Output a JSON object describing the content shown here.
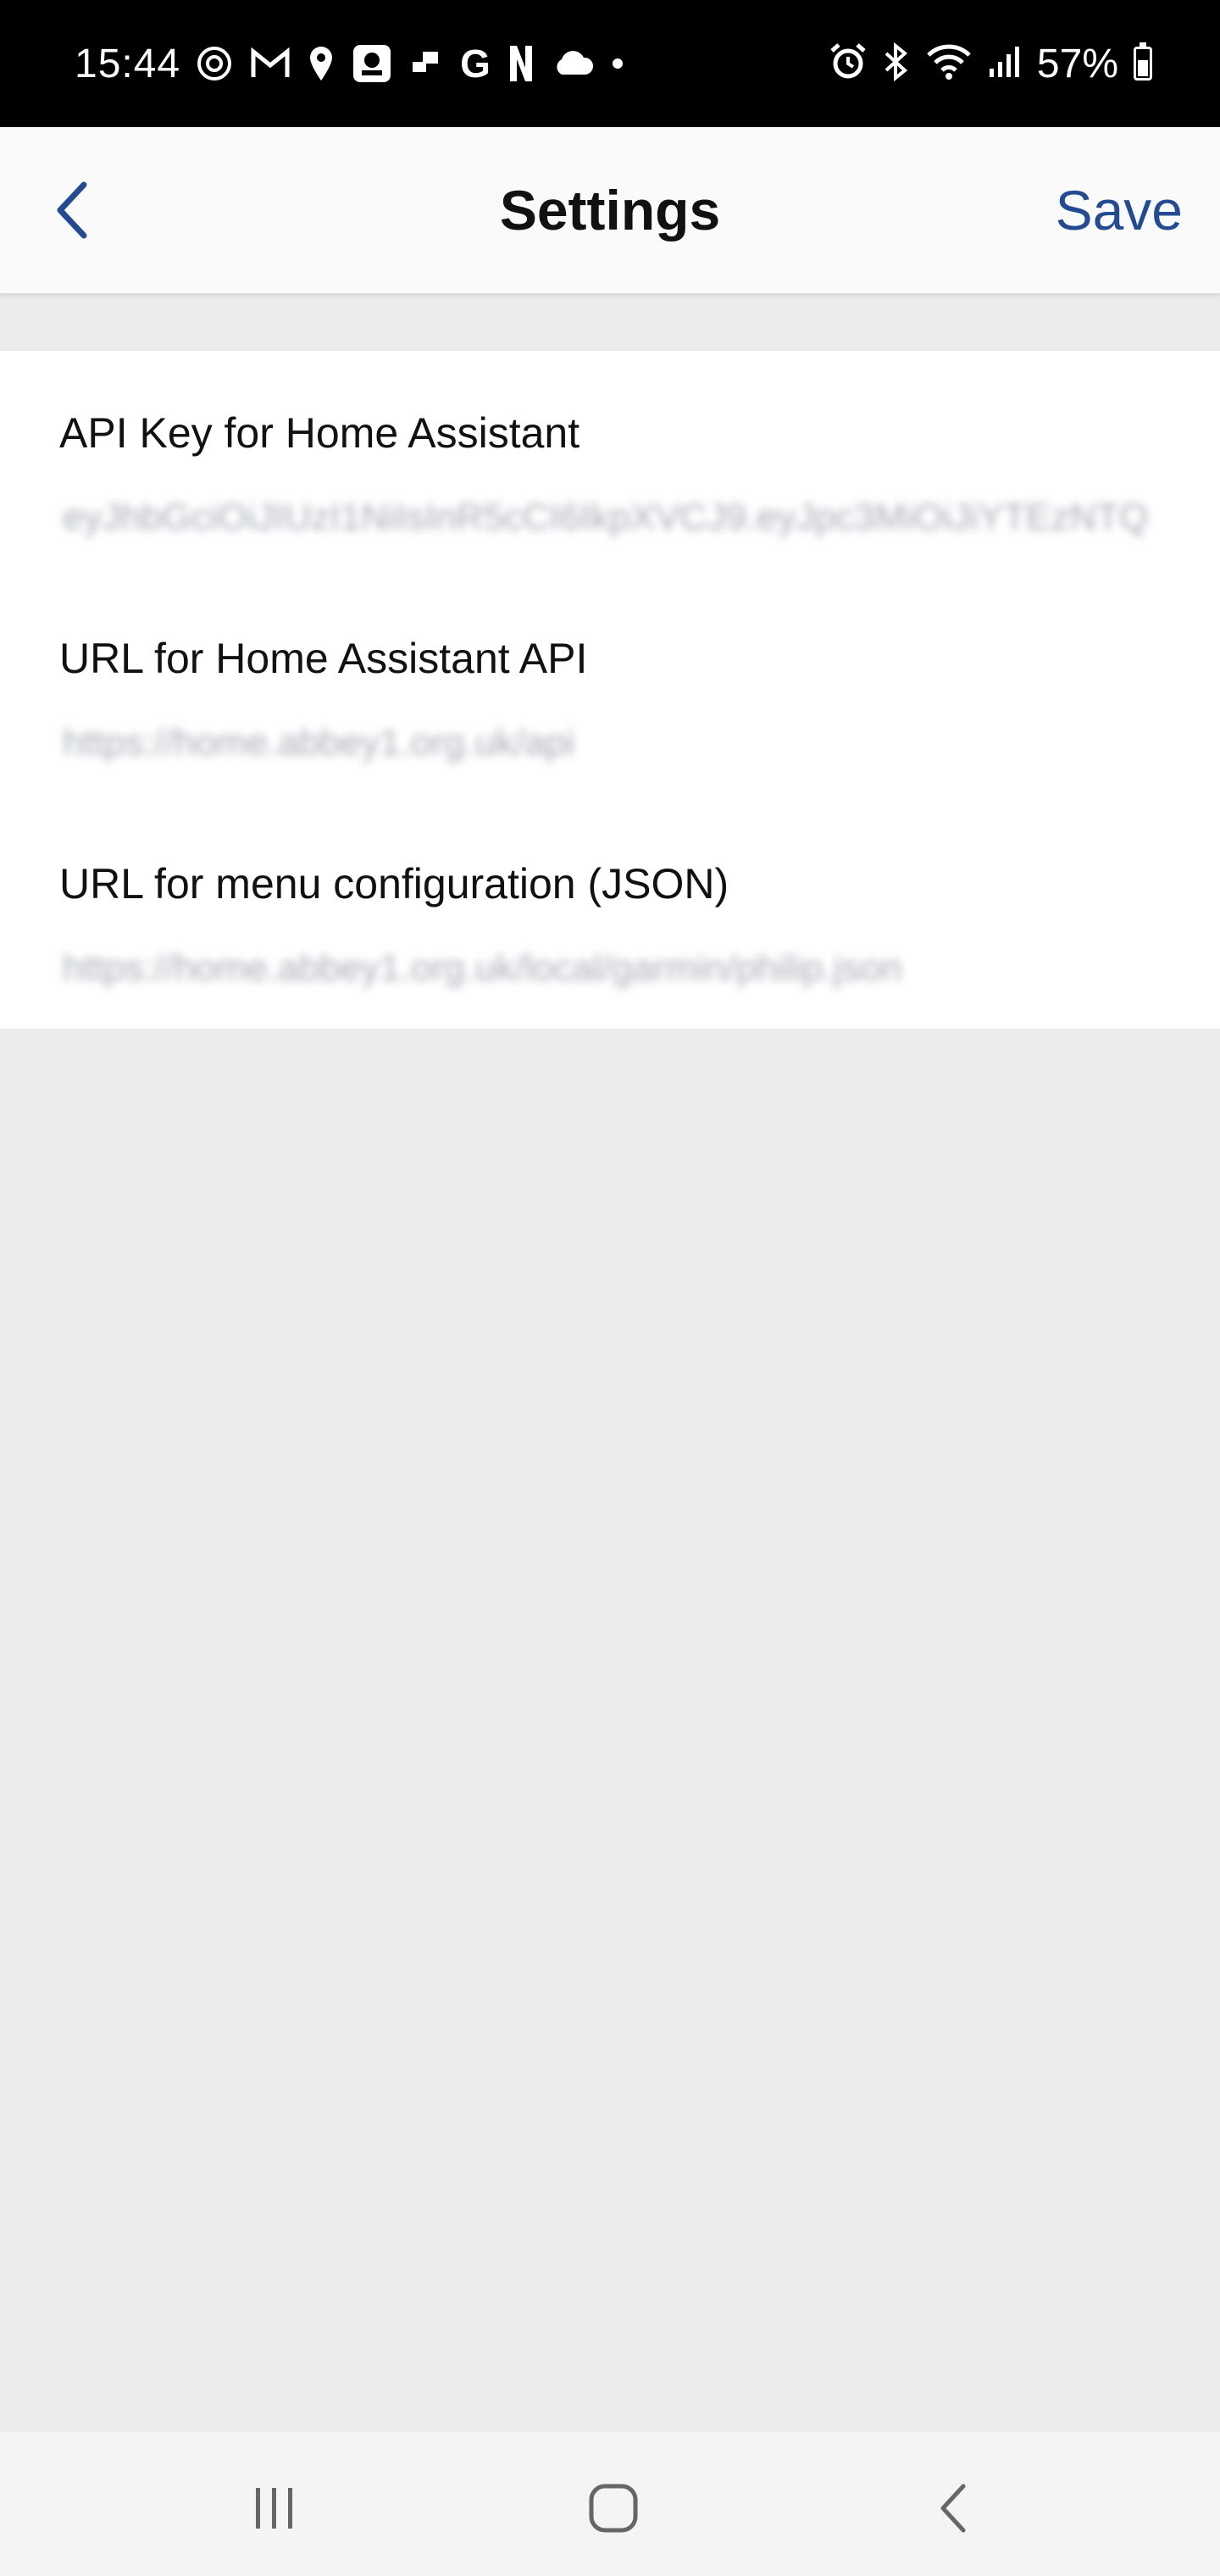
{
  "status_bar": {
    "time": "15:44",
    "battery_text": "57%",
    "battery_level": 0.57,
    "left_icons": [
      "threads-icon",
      "gmail-icon",
      "location-icon",
      "app-square-icon",
      "app-small-icon",
      "google-icon",
      "netflix-icon",
      "cloud-icon",
      "dot-icon"
    ],
    "right_icons": [
      "alarm-icon",
      "bluetooth-icon",
      "wifi-icon",
      "signal-icon",
      "battery-icon"
    ]
  },
  "app_bar": {
    "title": "Settings",
    "save_label": "Save",
    "accent_color": "#244b91"
  },
  "settings": [
    {
      "label": "API Key for Home Assistant",
      "value": "eyJhbGciOiJIUzI1NiIsInR5cCI6IkpXVCJ9.eyJpc3MiOiJiYTEzNTQ"
    },
    {
      "label": "URL for Home Assistant API",
      "value": "https://home.abbey1.org.uk/api"
    },
    {
      "label": "URL for menu configuration (JSON)",
      "value": "https://home.abbey1.org.uk/local/garmin/philip.json"
    }
  ],
  "nav_bar": {
    "buttons": [
      "recent-apps-icon",
      "home-icon",
      "back-icon"
    ]
  }
}
